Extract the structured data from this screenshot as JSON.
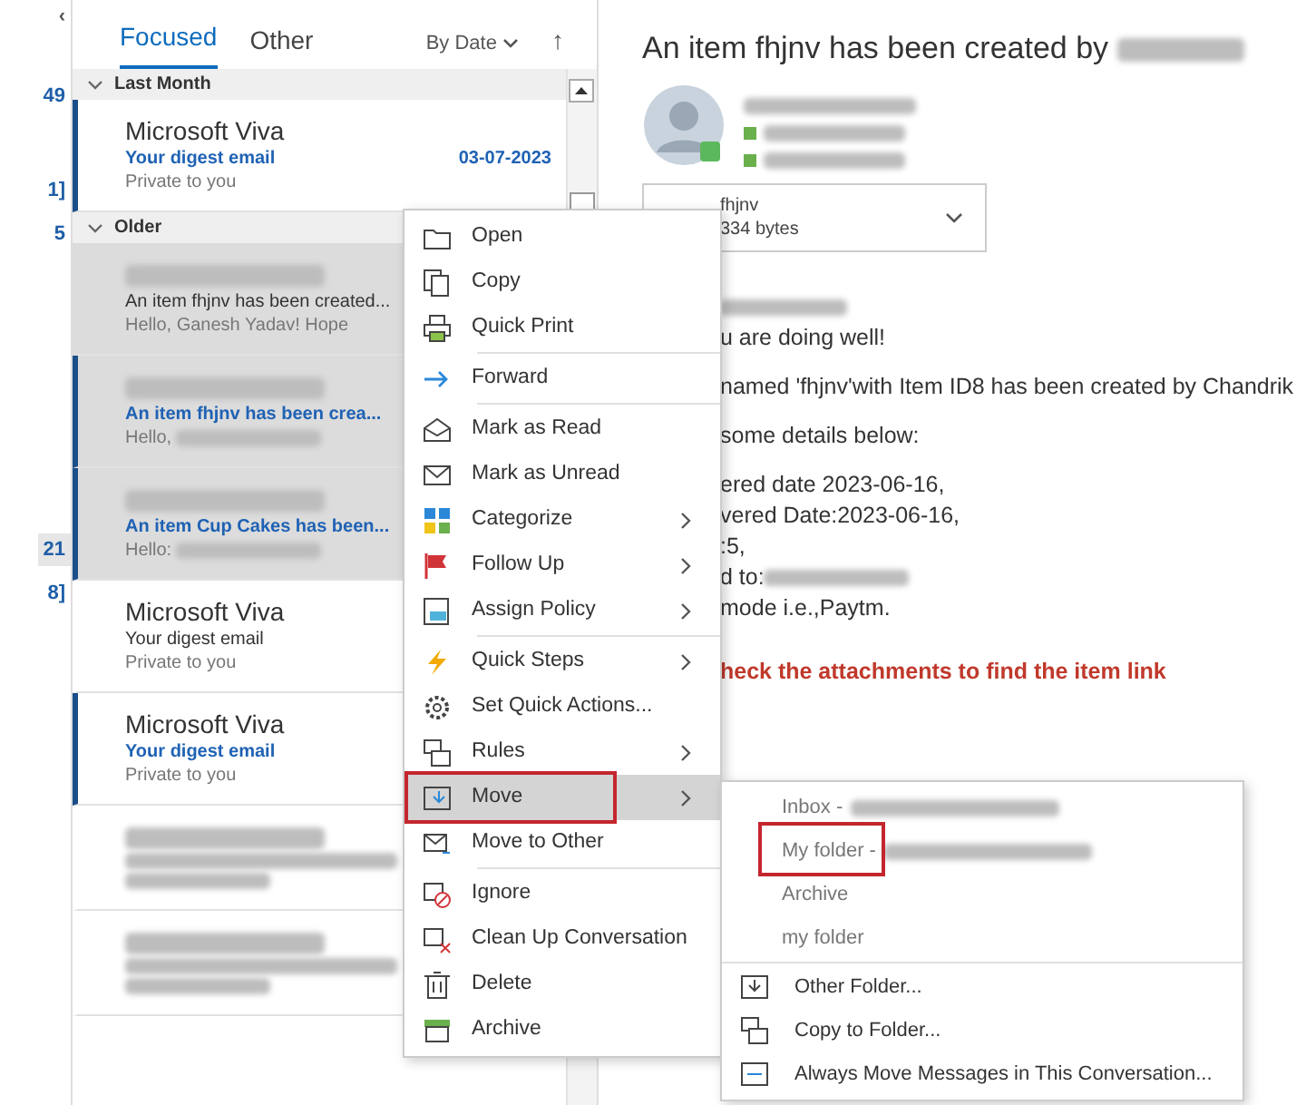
{
  "folder_pane": {
    "back_glyph": "‹",
    "counts": [
      {
        "text": "49",
        "selected": false
      },
      {
        "text": "1]",
        "selected": false
      },
      {
        "text": "5",
        "selected": false
      },
      {
        "text": "21",
        "selected": true
      },
      {
        "text": "8]",
        "selected": false
      }
    ]
  },
  "message_list": {
    "tabs": [
      {
        "label": "Focused",
        "selected": true
      },
      {
        "label": "Other",
        "selected": false
      }
    ],
    "sort": "By Date",
    "sort_direction_glyph": "↑",
    "groups": [
      {
        "label": "Last Month",
        "expanded": true,
        "messages": [
          {
            "sender": "Microsoft Viva",
            "subject": "Your digest email",
            "date": "03-07-2023",
            "preview": "Private to you",
            "unread": true,
            "selected": false
          }
        ]
      },
      {
        "label": "Older",
        "expanded": true,
        "messages": [
          {
            "sender_blur": true,
            "subject": "An item fhjnv has been created...",
            "preview": "Hello, Ganesh Yadav!  Hope",
            "unread": false,
            "selected": true
          },
          {
            "sender_blur": true,
            "subject": "An item fhjnv has been crea...",
            "preview": "Hello,",
            "preview_blur": true,
            "unread": true,
            "selected": true
          },
          {
            "sender_blur": true,
            "subject": "An item Cup Cakes has been...",
            "preview": "Hello:",
            "preview_blur": true,
            "unread": true,
            "selected": true
          },
          {
            "sender": "Microsoft Viva",
            "subject": "Your digest email",
            "preview": "Private to you",
            "unread": false,
            "selected": false
          },
          {
            "sender": "Microsoft Viva",
            "subject": "Your digest email",
            "preview": "Private to you",
            "unread": true,
            "selected": false
          },
          {
            "sender_blur": true,
            "subject_blur": true,
            "preview_blur": true,
            "unread": false,
            "selected": false
          },
          {
            "sender_blur": true,
            "subject_blur": true,
            "preview_blur": true,
            "unread": false,
            "selected": false
          }
        ]
      }
    ]
  },
  "reading_pane": {
    "title": "An item fhjnv has been created by",
    "title_blur": true,
    "header_lines": [
      {
        "kind": "sender"
      },
      {
        "kind": "recipient"
      },
      {
        "kind": "recipient"
      }
    ],
    "attachment": {
      "name": "fhjnv",
      "size": "334 bytes"
    },
    "body": [
      {
        "kind": "blur"
      },
      {
        "kind": "text",
        "text": "u are doing well!"
      },
      {
        "kind": "gap"
      },
      {
        "kind": "text",
        "text": "named 'fhjnv'with Item ID8 has been created by Chandrik"
      },
      {
        "kind": "gap"
      },
      {
        "kind": "text",
        "text": "some details below:"
      },
      {
        "kind": "gap"
      },
      {
        "kind": "text",
        "text": "ered date  2023-06-16,"
      },
      {
        "kind": "text",
        "text": "vered Date:2023-06-16,"
      },
      {
        "kind": "text",
        "text": ":5,"
      },
      {
        "kind": "text",
        "text": "d to:",
        "blur": true
      },
      {
        "kind": "text",
        "text": "mode i.e.,Paytm."
      },
      {
        "kind": "gap"
      },
      {
        "kind": "alert",
        "text": "heck the attachments to find the item link"
      }
    ]
  },
  "context_menu": {
    "items": [
      {
        "kind": "item",
        "label": "Open",
        "submenu": false,
        "selected": false
      },
      {
        "kind": "item",
        "label": "Copy",
        "submenu": false,
        "selected": false
      },
      {
        "kind": "item",
        "label": "Quick Print",
        "submenu": false,
        "selected": false
      },
      {
        "kind": "separator"
      },
      {
        "kind": "item",
        "label": "Forward",
        "submenu": false,
        "selected": false
      },
      {
        "kind": "separator"
      },
      {
        "kind": "item",
        "label": "Mark as Read",
        "submenu": false,
        "selected": false
      },
      {
        "kind": "item",
        "label": "Mark as Unread",
        "submenu": false,
        "selected": false
      },
      {
        "kind": "item",
        "label": "Categorize",
        "submenu": true,
        "selected": false
      },
      {
        "kind": "item",
        "label": "Follow Up",
        "submenu": true,
        "selected": false
      },
      {
        "kind": "item",
        "label": "Assign Policy",
        "submenu": true,
        "selected": false
      },
      {
        "kind": "separator"
      },
      {
        "kind": "item",
        "label": "Quick Steps",
        "submenu": true,
        "selected": false
      },
      {
        "kind": "item",
        "label": "Set Quick Actions...",
        "submenu": false,
        "selected": false
      },
      {
        "kind": "item",
        "label": "Rules",
        "submenu": true,
        "selected": false
      },
      {
        "kind": "item",
        "label": "Move",
        "submenu": true,
        "selected": true,
        "outlined": true
      },
      {
        "kind": "item",
        "label": "Move to Other",
        "submenu": false,
        "selected": false
      },
      {
        "kind": "separator"
      },
      {
        "kind": "item",
        "label": "Ignore",
        "submenu": false,
        "selected": false
      },
      {
        "kind": "item",
        "label": "Clean Up Conversation",
        "submenu": false,
        "selected": false
      },
      {
        "kind": "item",
        "label": "Delete",
        "submenu": false,
        "selected": false
      },
      {
        "kind": "item",
        "label": "Archive",
        "submenu": false,
        "selected": false
      }
    ]
  },
  "move_submenu": {
    "items": [
      {
        "kind": "folder",
        "label": "Inbox -",
        "blur": true
      },
      {
        "kind": "folder",
        "label": "My folder -",
        "blur": true,
        "outlined": true
      },
      {
        "kind": "folder",
        "label": "Archive"
      },
      {
        "kind": "folder",
        "label": "my folder"
      },
      {
        "kind": "separator"
      },
      {
        "kind": "action",
        "label": "Other Folder..."
      },
      {
        "kind": "action",
        "label": "Copy to Folder..."
      },
      {
        "kind": "action",
        "label": "Always Move Messages in This Conversation..."
      }
    ]
  }
}
